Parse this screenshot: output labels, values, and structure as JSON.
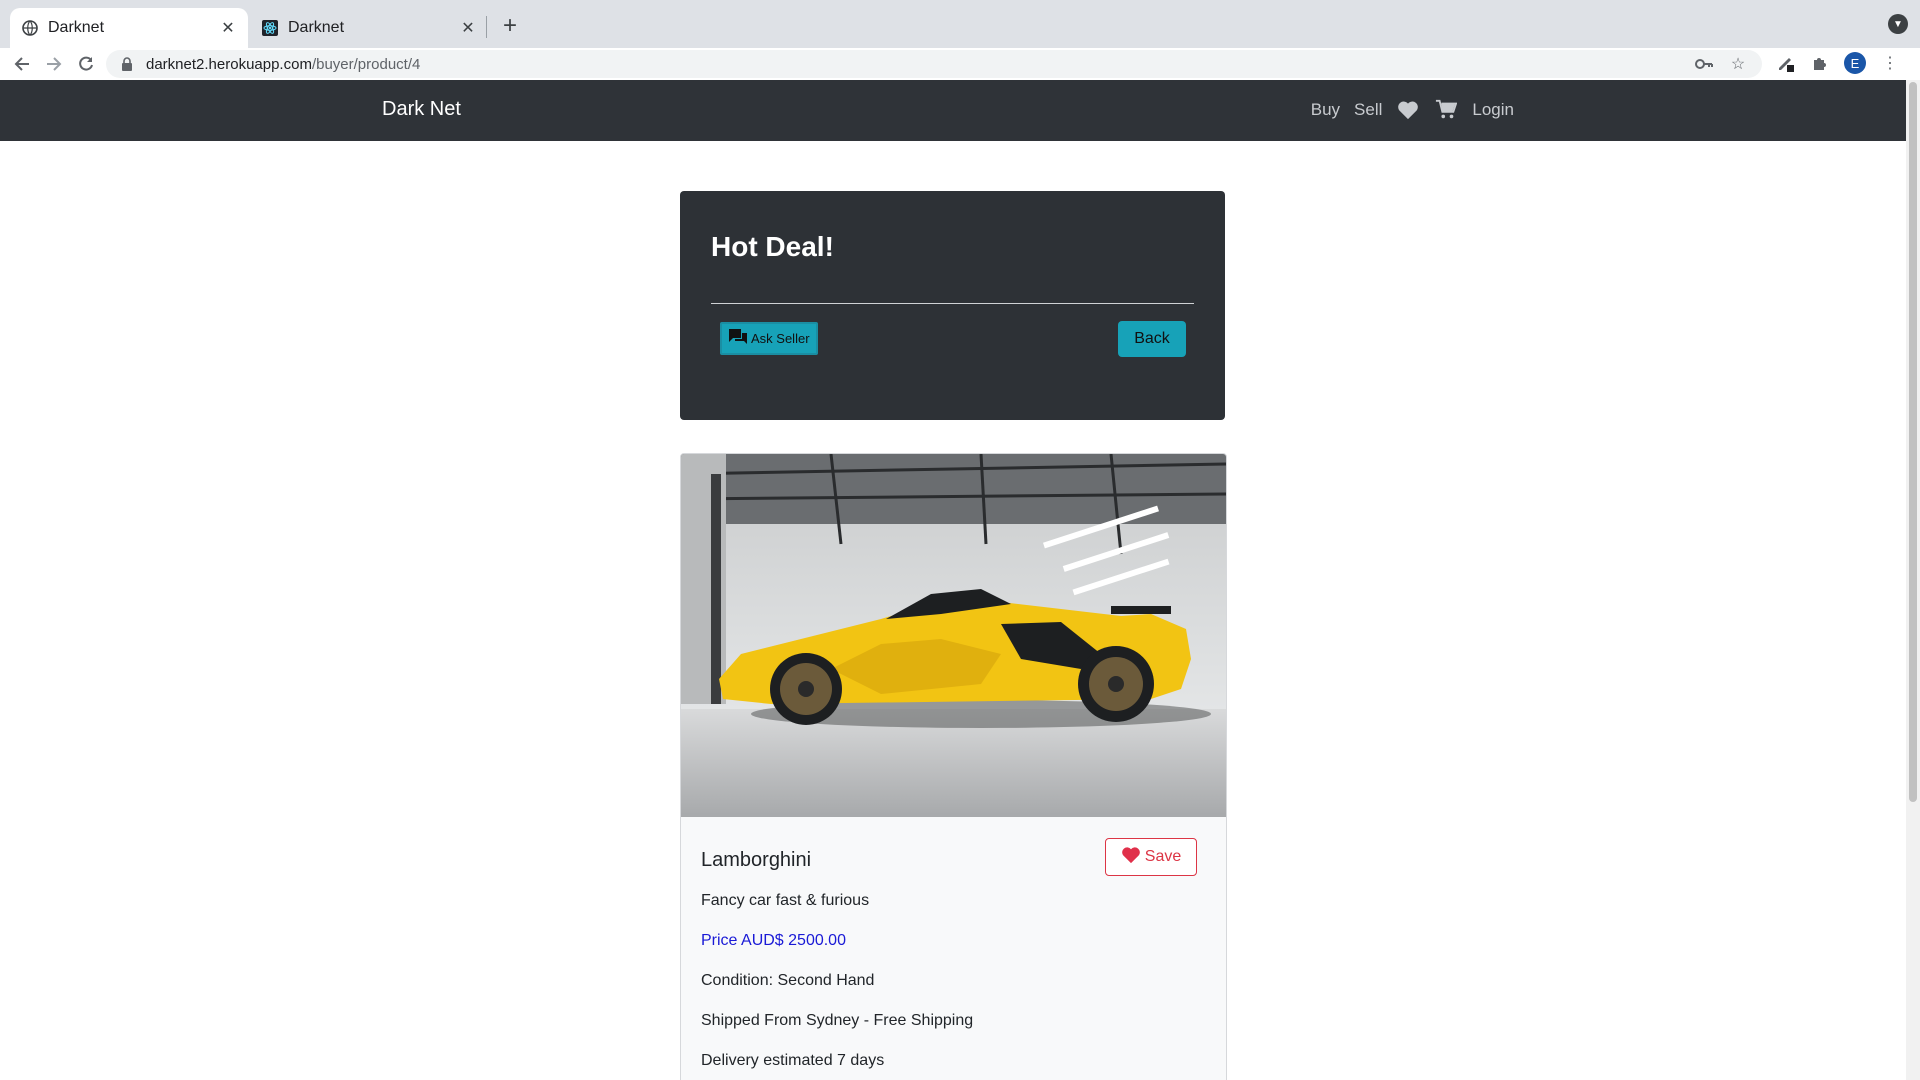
{
  "browser": {
    "tabs": [
      {
        "title": "Darknet"
      },
      {
        "title": "Darknet"
      }
    ],
    "url_host": "darknet2.herokuapp.com",
    "url_path": "/buyer/product/4",
    "profile_initial": "E"
  },
  "site": {
    "brand": "Dark Net",
    "nav": {
      "buy": "Buy",
      "sell": "Sell",
      "login": "Login"
    }
  },
  "hero": {
    "title": "Hot Deal!",
    "ask_seller": "Ask Seller",
    "back": "Back"
  },
  "product": {
    "name": "Lamborghini",
    "save_label": "Save",
    "description": "Fancy car fast & furious",
    "price": "Price AUD$ 2500.00",
    "condition": "Condition: Second Hand",
    "shipping": "Shipped From Sydney - Free Shipping",
    "delivery": "Delivery estimated 7 days"
  },
  "colors": {
    "navbar": "#2f3338",
    "accent": "#17a2b8",
    "danger": "#dc3545",
    "price": "#1a1ad6",
    "car": "#f2c413"
  },
  "icons": [
    "globe-icon",
    "react-icon",
    "close-icon",
    "plus-icon",
    "back-arrow-icon",
    "forward-arrow-icon",
    "reload-icon",
    "lock-icon",
    "key-icon",
    "star-icon",
    "extension-icon",
    "puzzle-icon",
    "menu-dots-icon",
    "heart-icon",
    "cart-icon",
    "chat-icon"
  ]
}
